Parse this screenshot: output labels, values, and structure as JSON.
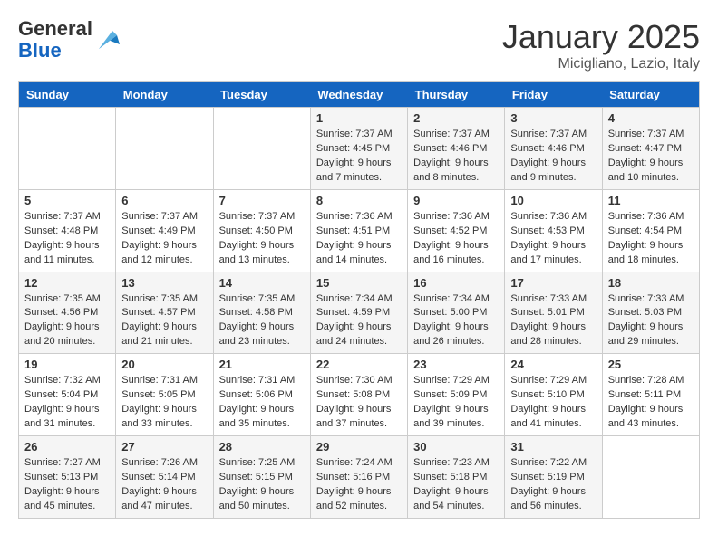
{
  "header": {
    "logo_general": "General",
    "logo_blue": "Blue",
    "month": "January 2025",
    "location": "Micigliano, Lazio, Italy"
  },
  "weekdays": [
    "Sunday",
    "Monday",
    "Tuesday",
    "Wednesday",
    "Thursday",
    "Friday",
    "Saturday"
  ],
  "weeks": [
    {
      "days": [
        {
          "num": "",
          "info": ""
        },
        {
          "num": "",
          "info": ""
        },
        {
          "num": "",
          "info": ""
        },
        {
          "num": "1",
          "info": "Sunrise: 7:37 AM\nSunset: 4:45 PM\nDaylight: 9 hours\nand 7 minutes."
        },
        {
          "num": "2",
          "info": "Sunrise: 7:37 AM\nSunset: 4:46 PM\nDaylight: 9 hours\nand 8 minutes."
        },
        {
          "num": "3",
          "info": "Sunrise: 7:37 AM\nSunset: 4:46 PM\nDaylight: 9 hours\nand 9 minutes."
        },
        {
          "num": "4",
          "info": "Sunrise: 7:37 AM\nSunset: 4:47 PM\nDaylight: 9 hours\nand 10 minutes."
        }
      ]
    },
    {
      "days": [
        {
          "num": "5",
          "info": "Sunrise: 7:37 AM\nSunset: 4:48 PM\nDaylight: 9 hours\nand 11 minutes."
        },
        {
          "num": "6",
          "info": "Sunrise: 7:37 AM\nSunset: 4:49 PM\nDaylight: 9 hours\nand 12 minutes."
        },
        {
          "num": "7",
          "info": "Sunrise: 7:37 AM\nSunset: 4:50 PM\nDaylight: 9 hours\nand 13 minutes."
        },
        {
          "num": "8",
          "info": "Sunrise: 7:36 AM\nSunset: 4:51 PM\nDaylight: 9 hours\nand 14 minutes."
        },
        {
          "num": "9",
          "info": "Sunrise: 7:36 AM\nSunset: 4:52 PM\nDaylight: 9 hours\nand 16 minutes."
        },
        {
          "num": "10",
          "info": "Sunrise: 7:36 AM\nSunset: 4:53 PM\nDaylight: 9 hours\nand 17 minutes."
        },
        {
          "num": "11",
          "info": "Sunrise: 7:36 AM\nSunset: 4:54 PM\nDaylight: 9 hours\nand 18 minutes."
        }
      ]
    },
    {
      "days": [
        {
          "num": "12",
          "info": "Sunrise: 7:35 AM\nSunset: 4:56 PM\nDaylight: 9 hours\nand 20 minutes."
        },
        {
          "num": "13",
          "info": "Sunrise: 7:35 AM\nSunset: 4:57 PM\nDaylight: 9 hours\nand 21 minutes."
        },
        {
          "num": "14",
          "info": "Sunrise: 7:35 AM\nSunset: 4:58 PM\nDaylight: 9 hours\nand 23 minutes."
        },
        {
          "num": "15",
          "info": "Sunrise: 7:34 AM\nSunset: 4:59 PM\nDaylight: 9 hours\nand 24 minutes."
        },
        {
          "num": "16",
          "info": "Sunrise: 7:34 AM\nSunset: 5:00 PM\nDaylight: 9 hours\nand 26 minutes."
        },
        {
          "num": "17",
          "info": "Sunrise: 7:33 AM\nSunset: 5:01 PM\nDaylight: 9 hours\nand 28 minutes."
        },
        {
          "num": "18",
          "info": "Sunrise: 7:33 AM\nSunset: 5:03 PM\nDaylight: 9 hours\nand 29 minutes."
        }
      ]
    },
    {
      "days": [
        {
          "num": "19",
          "info": "Sunrise: 7:32 AM\nSunset: 5:04 PM\nDaylight: 9 hours\nand 31 minutes."
        },
        {
          "num": "20",
          "info": "Sunrise: 7:31 AM\nSunset: 5:05 PM\nDaylight: 9 hours\nand 33 minutes."
        },
        {
          "num": "21",
          "info": "Sunrise: 7:31 AM\nSunset: 5:06 PM\nDaylight: 9 hours\nand 35 minutes."
        },
        {
          "num": "22",
          "info": "Sunrise: 7:30 AM\nSunset: 5:08 PM\nDaylight: 9 hours\nand 37 minutes."
        },
        {
          "num": "23",
          "info": "Sunrise: 7:29 AM\nSunset: 5:09 PM\nDaylight: 9 hours\nand 39 minutes."
        },
        {
          "num": "24",
          "info": "Sunrise: 7:29 AM\nSunset: 5:10 PM\nDaylight: 9 hours\nand 41 minutes."
        },
        {
          "num": "25",
          "info": "Sunrise: 7:28 AM\nSunset: 5:11 PM\nDaylight: 9 hours\nand 43 minutes."
        }
      ]
    },
    {
      "days": [
        {
          "num": "26",
          "info": "Sunrise: 7:27 AM\nSunset: 5:13 PM\nDaylight: 9 hours\nand 45 minutes."
        },
        {
          "num": "27",
          "info": "Sunrise: 7:26 AM\nSunset: 5:14 PM\nDaylight: 9 hours\nand 47 minutes."
        },
        {
          "num": "28",
          "info": "Sunrise: 7:25 AM\nSunset: 5:15 PM\nDaylight: 9 hours\nand 50 minutes."
        },
        {
          "num": "29",
          "info": "Sunrise: 7:24 AM\nSunset: 5:16 PM\nDaylight: 9 hours\nand 52 minutes."
        },
        {
          "num": "30",
          "info": "Sunrise: 7:23 AM\nSunset: 5:18 PM\nDaylight: 9 hours\nand 54 minutes."
        },
        {
          "num": "31",
          "info": "Sunrise: 7:22 AM\nSunset: 5:19 PM\nDaylight: 9 hours\nand 56 minutes."
        },
        {
          "num": "",
          "info": ""
        }
      ]
    }
  ]
}
